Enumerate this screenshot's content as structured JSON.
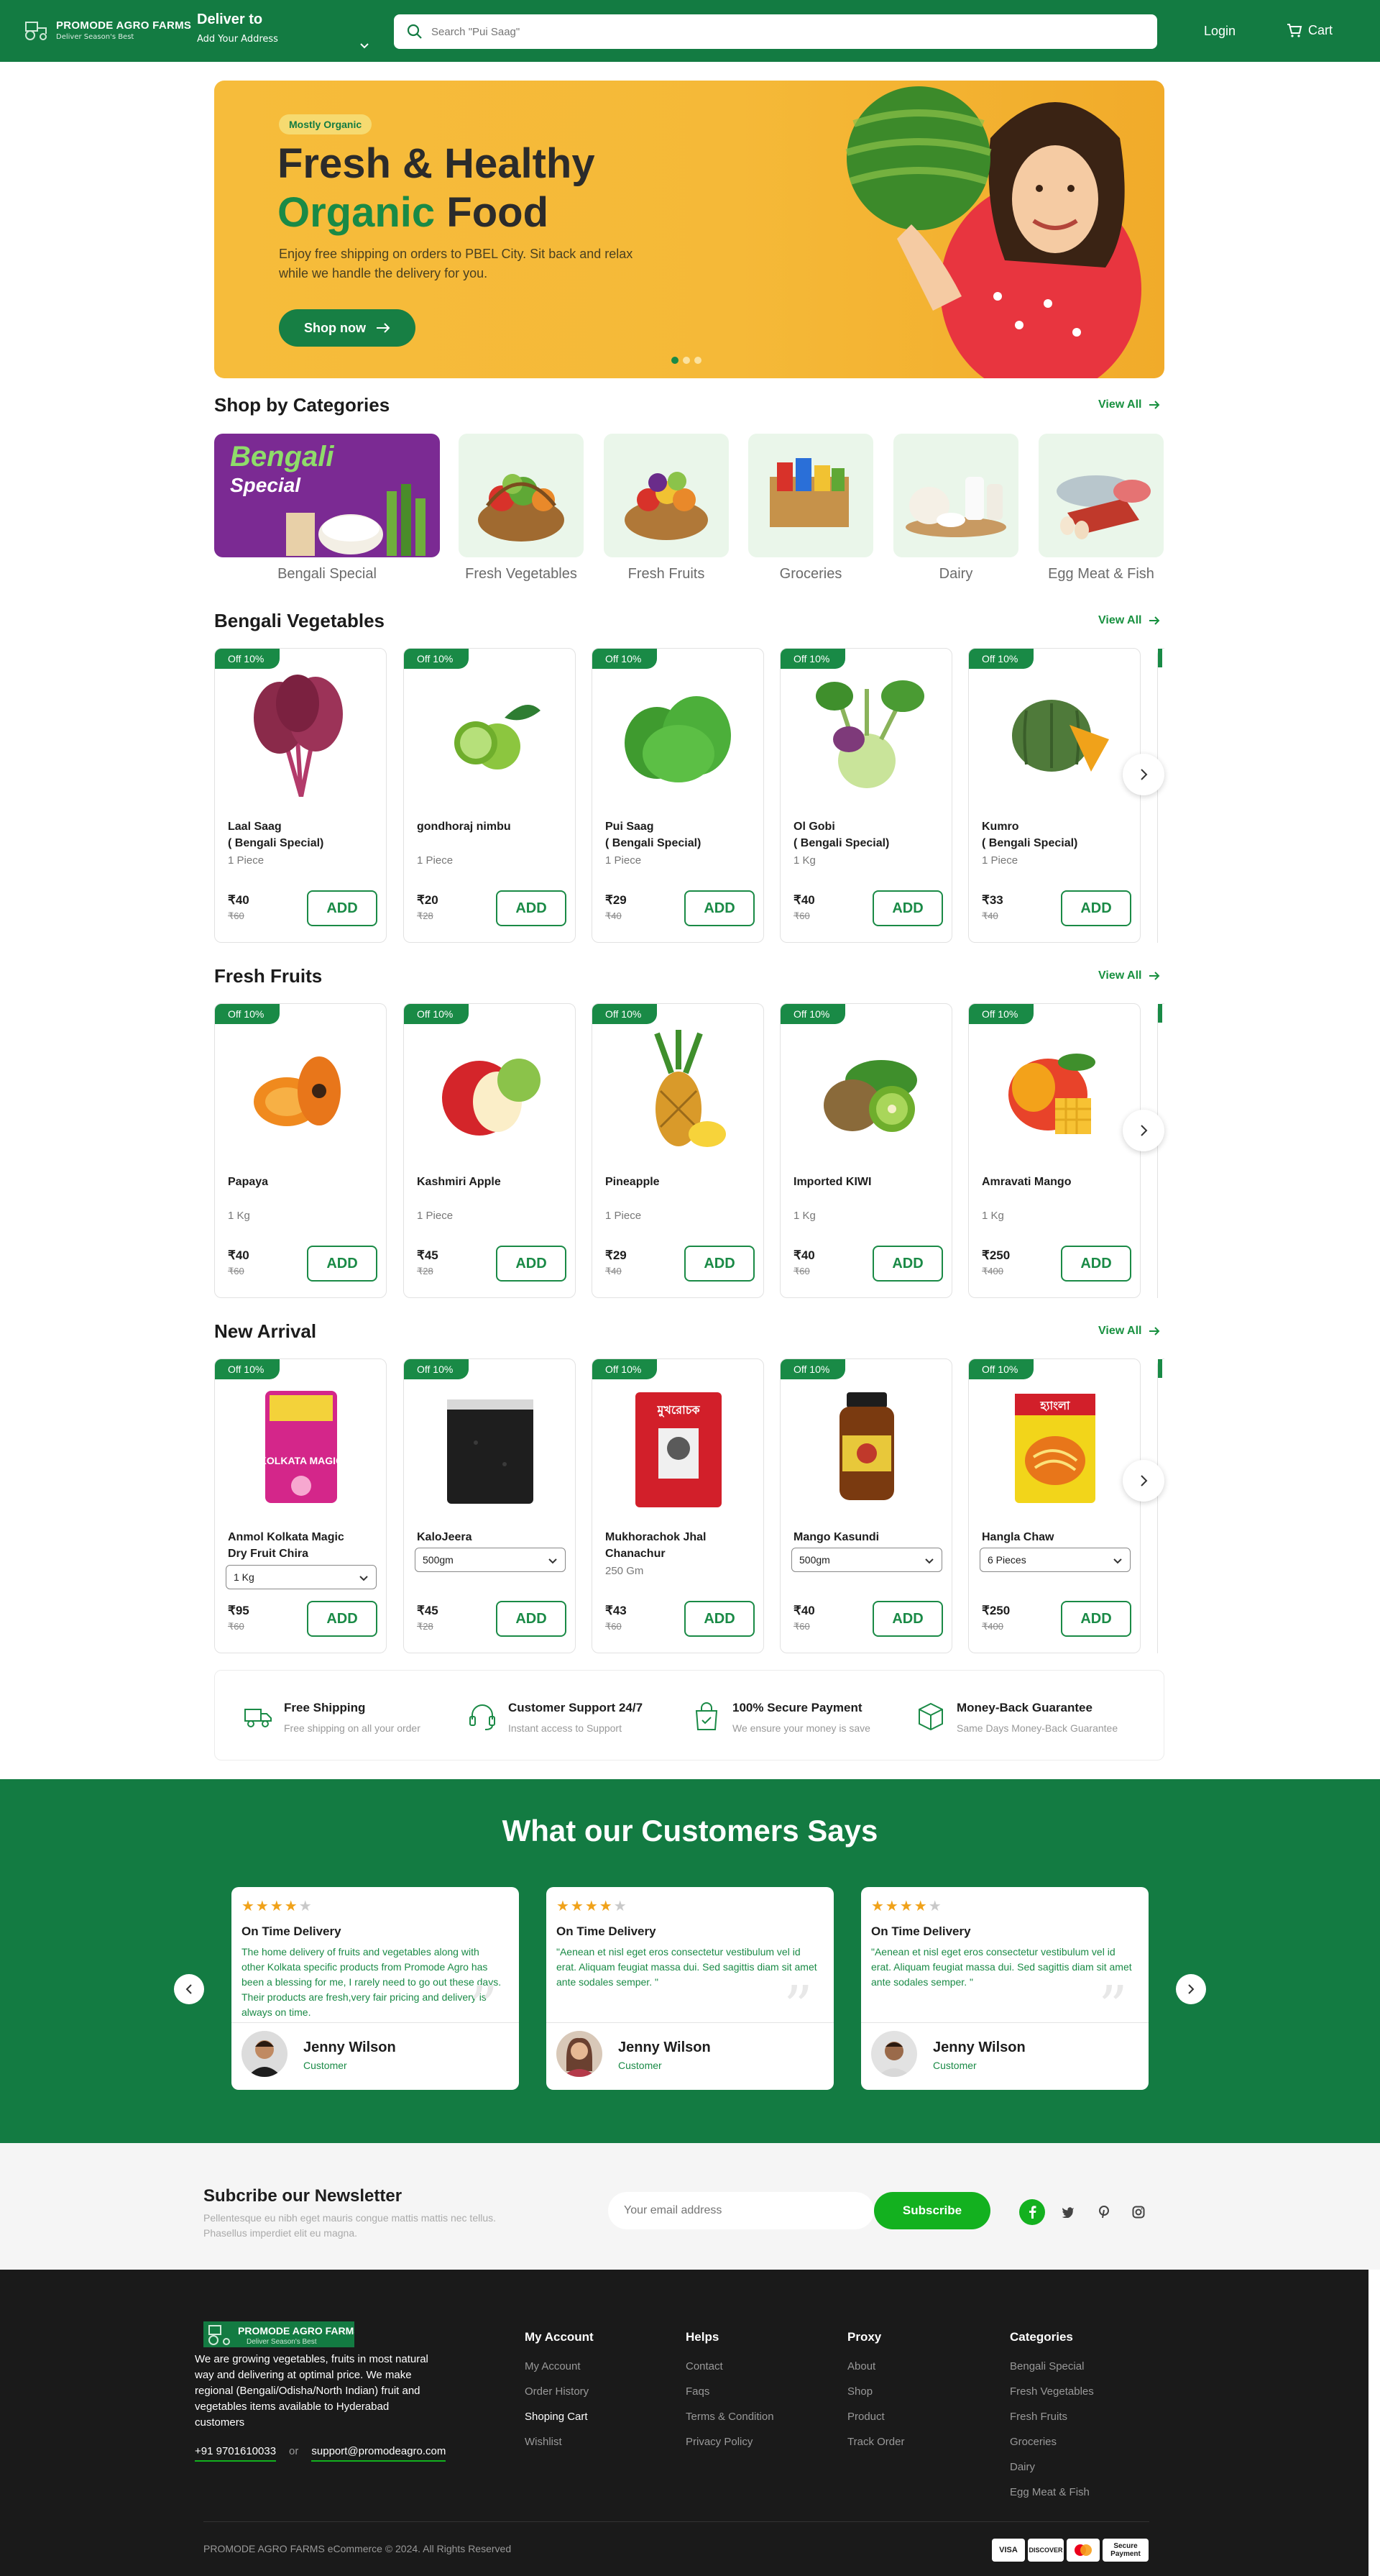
{
  "header": {
    "brand": "PROMODE AGRO FARMS",
    "tagline": "Deliver Season's Best",
    "deliver_title": "Deliver to",
    "deliver_sub": "Add Your Address",
    "search_placeholder": "Search \"Pui Saag\"",
    "login": "Login",
    "cart": "Cart"
  },
  "hero": {
    "badge": "Mostly Organic",
    "line1": "Fresh & Healthy",
    "line2a": "Organic",
    "line2b": "Food",
    "desc": "Enjoy free shipping on orders to PBEL City. Sit back and relax while we handle the delivery for you.",
    "cta": "Shop now",
    "slides": 3,
    "active_slide": 1
  },
  "categories": {
    "title": "Shop by Categories",
    "view_all": "View All",
    "bengali_word": "Bengali",
    "special_word": "Special",
    "items": [
      "Bengali Special",
      "Fresh Vegetables",
      "Fresh Fruits",
      "Groceries",
      "Dairy",
      "Egg Meat & Fish"
    ]
  },
  "vegetables": {
    "title": "Bengali Vegetables",
    "view_all": "View All",
    "items": [
      {
        "off": "Off 10%",
        "name": "Laal Saag",
        "name2": "( Bengali Special)",
        "qty": "1 Piece",
        "price": "₹40",
        "mrp": "₹60",
        "add": "ADD"
      },
      {
        "off": "Off 10%",
        "name": "gondhoraj nimbu",
        "name2": "",
        "qty": "1 Piece",
        "price": "₹20",
        "mrp": "₹28",
        "add": "ADD"
      },
      {
        "off": "Off 10%",
        "name": "Pui Saag",
        "name2": "( Bengali Special)",
        "qty": "1 Piece",
        "price": "₹29",
        "mrp": "₹40",
        "add": "ADD"
      },
      {
        "off": "Off 10%",
        "name": "Ol Gobi",
        "name2": "( Bengali Special)",
        "qty": "1 Kg",
        "price": "₹40",
        "mrp": "₹60",
        "add": "ADD"
      },
      {
        "off": "Off 10%",
        "name": "Kumro",
        "name2": "( Bengali Special)",
        "qty": "1 Piece",
        "price": "₹33",
        "mrp": "₹40",
        "add": "ADD"
      }
    ]
  },
  "fruits": {
    "title": "Fresh Fruits",
    "view_all": "View All",
    "items": [
      {
        "off": "Off 10%",
        "name": "Papaya",
        "qty": "1 Kg",
        "price": "₹40",
        "mrp": "₹60",
        "add": "ADD"
      },
      {
        "off": "Off 10%",
        "name": "Kashmiri Apple",
        "qty": "1 Piece",
        "price": "₹45",
        "mrp": "₹28",
        "add": "ADD"
      },
      {
        "off": "Off 10%",
        "name": "Pineapple",
        "qty": "1 Piece",
        "price": "₹29",
        "mrp": "₹40",
        "add": "ADD"
      },
      {
        "off": "Off 10%",
        "name": "Imported KIWI",
        "qty": "1 Kg",
        "price": "₹40",
        "mrp": "₹60",
        "add": "ADD"
      },
      {
        "off": "Off 10%",
        "name": "Amravati Mango",
        "qty": "1 Kg",
        "price": "₹250",
        "mrp": "₹400",
        "add": "ADD"
      }
    ]
  },
  "arrivals": {
    "title": "New Arrival",
    "view_all": "View All",
    "items": [
      {
        "off": "Off 10%",
        "name": "Anmol Kolkata Magic",
        "name2": "Dry Fruit Chira",
        "select": "1 Kg",
        "price": "₹95",
        "mrp": "₹60",
        "add": "ADD",
        "pack_text": "KOLKATA MAGIC"
      },
      {
        "off": "Off 10%",
        "name": "KaloJeera",
        "name2": "",
        "select": "500gm",
        "price": "₹45",
        "mrp": "₹28",
        "add": "ADD",
        "pack_text": ""
      },
      {
        "off": "Off 10%",
        "name": "Mukhorachok Jhal",
        "name2": "Chanachur",
        "qty": "250 Gm",
        "price": "₹43",
        "mrp": "₹60",
        "add": "ADD",
        "pack_text": "মুখরোচক"
      },
      {
        "off": "Off 10%",
        "name": "Mango Kasundi",
        "name2": "",
        "select": "500gm",
        "price": "₹40",
        "mrp": "₹60",
        "add": "ADD",
        "pack_text": ""
      },
      {
        "off": "Off 10%",
        "name": "Hangla Chaw",
        "name2": "",
        "select": "6 Pieces",
        "price": "₹250",
        "mrp": "₹400",
        "add": "ADD",
        "pack_text": "হ্যাংলা"
      }
    ]
  },
  "features": [
    {
      "title": "Free Shipping",
      "sub": "Free shipping on all your order"
    },
    {
      "title": "Customer Support 24/7",
      "sub": "Instant access to Support"
    },
    {
      "title": "100% Secure Payment",
      "sub": "We ensure your money is save"
    },
    {
      "title": "Money-Back Guarantee",
      "sub": "Same Days Money-Back Guarantee"
    }
  ],
  "testimonials": {
    "title": "What our Customers Says",
    "items": [
      {
        "rating": 4,
        "heading": "On Time Delivery",
        "text": "The home delivery of fruits and vegetables along with other Kolkata specific products from Promode Agro has been a blessing for me, I rarely need to go out these days. Their products are fresh,very fair pricing and delivery is always on time.",
        "name": "Jenny Wilson",
        "role": "Customer"
      },
      {
        "rating": 4,
        "heading": "On Time Delivery",
        "text": "\"Aenean et nisl eget eros consectetur vestibulum vel id erat. Aliquam feugiat massa dui. Sed sagittis diam sit amet ante sodales semper. \"",
        "name": "Jenny Wilson",
        "role": "Customer"
      },
      {
        "rating": 4,
        "heading": "On Time Delivery",
        "text": "\"Aenean et nisl eget eros consectetur vestibulum vel id erat. Aliquam feugiat massa dui. Sed sagittis diam sit amet ante sodales semper. \"",
        "name": "Jenny Wilson",
        "role": "Customer"
      }
    ]
  },
  "newsletter": {
    "title": "Subcribe our Newsletter",
    "sub": "Pellentesque eu nibh eget mauris congue mattis mattis nec tellus. Phasellus imperdiet elit eu magna.",
    "placeholder": "Your email address",
    "button": "Subscribe"
  },
  "footer": {
    "brand": "PROMODE AGRO FARMS",
    "tagline": "Deliver Season's Best",
    "about": "We are growing vegetables, fruits in most natural way and delivering at optimal price. We make regional (Bengali/Odisha/North Indian) fruit and vegetables items available to Hyderabad customers",
    "phone": "+91 9701610033",
    "or": "or",
    "email": "support@promodeagro.com",
    "columns": [
      {
        "heading": "My Account",
        "links": [
          "My Account",
          "Order History",
          "Shoping Cart",
          "Wishlist"
        ]
      },
      {
        "heading": "Helps",
        "links": [
          "Contact",
          "Faqs",
          "Terms & Condition",
          "Privacy Policy"
        ]
      },
      {
        "heading": "Proxy",
        "links": [
          "About",
          "Shop",
          "Product",
          "Track Order"
        ]
      },
      {
        "heading": "Categories",
        "links": [
          "Bengali Special",
          "Fresh Vegetables",
          "Fresh Fruits",
          "Groceries",
          "Dairy",
          "Egg Meat & Fish"
        ]
      }
    ],
    "copyright": "PROMODE AGRO FARMS eCommerce © 2024. All Rights Reserved",
    "payments": [
      "VISA",
      "DISCOVER",
      "",
      "Secure Payment"
    ]
  },
  "colors": {
    "brand_green": "#137b42",
    "accent_green": "#1a8a46",
    "hero_yellow": "#f6bc3b",
    "footer_bg": "#1a1a1a"
  }
}
